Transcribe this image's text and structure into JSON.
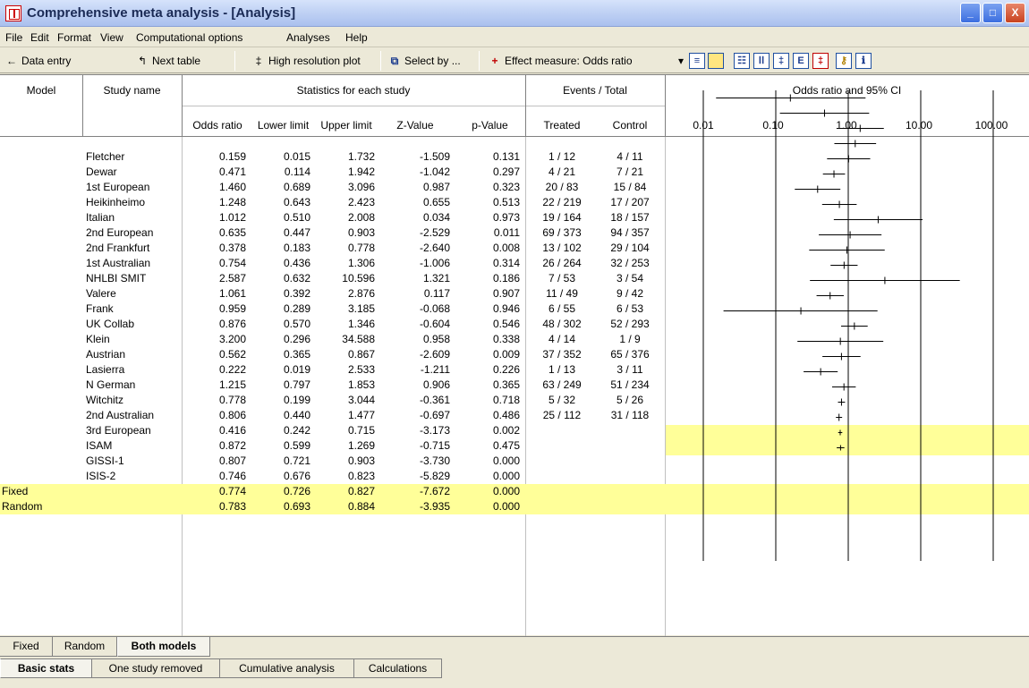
{
  "window": {
    "title": "Comprehensive meta analysis - [Analysis]",
    "minimize": "_",
    "maximize": "□",
    "close": "X"
  },
  "menu": [
    "File",
    "Edit",
    "Format",
    "View",
    "Computational options",
    "Analyses",
    "Help"
  ],
  "toolbar": {
    "data_entry": "Data entry",
    "next_table": "Next table",
    "high_res_plot": "High resolution plot",
    "select_by": "Select by ...",
    "effect_measure": "Effect measure: Odds ratio"
  },
  "table": {
    "headers": {
      "model": "Model",
      "study_name": "Study name",
      "stats_group": "Statistics for each study",
      "events_group": "Events / Total",
      "plot_group": "Odds ratio and 95% CI",
      "odds_ratio": "Odds ratio",
      "lower_limit": "Lower limit",
      "upper_limit": "Upper limit",
      "z_value": "Z-Value",
      "p_value": "p-Value",
      "treated": "Treated",
      "control": "Control"
    },
    "plot_ticks": [
      "0.01",
      "0.10",
      "1.00",
      "10.00",
      "100.00"
    ],
    "rows": [
      {
        "model": "",
        "study": "Fletcher",
        "or": "0.159",
        "ll": "0.015",
        "ul": "1.732",
        "z": "-1.509",
        "p": "0.131",
        "treated": "1 / 12",
        "control": "4 / 11"
      },
      {
        "model": "",
        "study": "Dewar",
        "or": "0.471",
        "ll": "0.114",
        "ul": "1.942",
        "z": "-1.042",
        "p": "0.297",
        "treated": "4 / 21",
        "control": "7 / 21"
      },
      {
        "model": "",
        "study": "1st European",
        "or": "1.460",
        "ll": "0.689",
        "ul": "3.096",
        "z": "0.987",
        "p": "0.323",
        "treated": "20 / 83",
        "control": "15 / 84"
      },
      {
        "model": "",
        "study": "Heikinheimo",
        "or": "1.248",
        "ll": "0.643",
        "ul": "2.423",
        "z": "0.655",
        "p": "0.513",
        "treated": "22 / 219",
        "control": "17 / 207"
      },
      {
        "model": "",
        "study": "Italian",
        "or": "1.012",
        "ll": "0.510",
        "ul": "2.008",
        "z": "0.034",
        "p": "0.973",
        "treated": "19 / 164",
        "control": "18 / 157"
      },
      {
        "model": "",
        "study": "2nd European",
        "or": "0.635",
        "ll": "0.447",
        "ul": "0.903",
        "z": "-2.529",
        "p": "0.011",
        "treated": "69 / 373",
        "control": "94 / 357"
      },
      {
        "model": "",
        "study": "2nd Frankfurt",
        "or": "0.378",
        "ll": "0.183",
        "ul": "0.778",
        "z": "-2.640",
        "p": "0.008",
        "treated": "13 / 102",
        "control": "29 / 104"
      },
      {
        "model": "",
        "study": "1st Australian",
        "or": "0.754",
        "ll": "0.436",
        "ul": "1.306",
        "z": "-1.006",
        "p": "0.314",
        "treated": "26 / 264",
        "control": "32 / 253"
      },
      {
        "model": "",
        "study": "NHLBI SMIT",
        "or": "2.587",
        "ll": "0.632",
        "ul": "10.596",
        "z": "1.321",
        "p": "0.186",
        "treated": "7 / 53",
        "control": "3 / 54"
      },
      {
        "model": "",
        "study": "Valere",
        "or": "1.061",
        "ll": "0.392",
        "ul": "2.876",
        "z": "0.117",
        "p": "0.907",
        "treated": "11 / 49",
        "control": "9 / 42"
      },
      {
        "model": "",
        "study": "Frank",
        "or": "0.959",
        "ll": "0.289",
        "ul": "3.185",
        "z": "-0.068",
        "p": "0.946",
        "treated": "6 / 55",
        "control": "6 / 53"
      },
      {
        "model": "",
        "study": "UK Collab",
        "or": "0.876",
        "ll": "0.570",
        "ul": "1.346",
        "z": "-0.604",
        "p": "0.546",
        "treated": "48 / 302",
        "control": "52 / 293"
      },
      {
        "model": "",
        "study": "Klein",
        "or": "3.200",
        "ll": "0.296",
        "ul": "34.588",
        "z": "0.958",
        "p": "0.338",
        "treated": "4 / 14",
        "control": "1 / 9"
      },
      {
        "model": "",
        "study": "Austrian",
        "or": "0.562",
        "ll": "0.365",
        "ul": "0.867",
        "z": "-2.609",
        "p": "0.009",
        "treated": "37 / 352",
        "control": "65 / 376"
      },
      {
        "model": "",
        "study": "Lasierra",
        "or": "0.222",
        "ll": "0.019",
        "ul": "2.533",
        "z": "-1.211",
        "p": "0.226",
        "treated": "1 / 13",
        "control": "3 / 11"
      },
      {
        "model": "",
        "study": "N German",
        "or": "1.215",
        "ll": "0.797",
        "ul": "1.853",
        "z": "0.906",
        "p": "0.365",
        "treated": "63 / 249",
        "control": "51 / 234"
      },
      {
        "model": "",
        "study": "Witchitz",
        "or": "0.778",
        "ll": "0.199",
        "ul": "3.044",
        "z": "-0.361",
        "p": "0.718",
        "treated": "5 / 32",
        "control": "5 / 26"
      },
      {
        "model": "",
        "study": "2nd Australian",
        "or": "0.806",
        "ll": "0.440",
        "ul": "1.477",
        "z": "-0.697",
        "p": "0.486",
        "treated": "25 / 112",
        "control": "31 / 118"
      },
      {
        "model": "",
        "study": "3rd European",
        "or": "0.416",
        "ll": "0.242",
        "ul": "0.715",
        "z": "-3.173",
        "p": "0.002",
        "treated": "",
        "control": ""
      },
      {
        "model": "",
        "study": "ISAM",
        "or": "0.872",
        "ll": "0.599",
        "ul": "1.269",
        "z": "-0.715",
        "p": "0.475",
        "treated": "",
        "control": ""
      },
      {
        "model": "",
        "study": "GISSI-1",
        "or": "0.807",
        "ll": "0.721",
        "ul": "0.903",
        "z": "-3.730",
        "p": "0.000",
        "treated": "",
        "control": ""
      },
      {
        "model": "",
        "study": "ISIS-2",
        "or": "0.746",
        "ll": "0.676",
        "ul": "0.823",
        "z": "-5.829",
        "p": "0.000",
        "treated": "",
        "control": ""
      },
      {
        "model": "Fixed",
        "study": "",
        "or": "0.774",
        "ll": "0.726",
        "ul": "0.827",
        "z": "-7.672",
        "p": "0.000",
        "treated": "",
        "control": "",
        "summary": true
      },
      {
        "model": "Random",
        "study": "",
        "or": "0.783",
        "ll": "0.693",
        "ul": "0.884",
        "z": "-3.935",
        "p": "0.000",
        "treated": "",
        "control": "",
        "summary": true
      }
    ]
  },
  "tabs_models": [
    {
      "label": "Fixed",
      "active": false
    },
    {
      "label": "Random",
      "active": false
    },
    {
      "label": "Both models",
      "active": true
    }
  ],
  "tabs_views": [
    {
      "label": "Basic stats",
      "active": true
    },
    {
      "label": "One study removed",
      "active": false
    },
    {
      "label": "Cumulative analysis",
      "active": false
    },
    {
      "label": "Calculations",
      "active": false
    }
  ],
  "colors": {
    "summary_row": "#ffff99",
    "effect_measure_icon": "#c00000"
  }
}
